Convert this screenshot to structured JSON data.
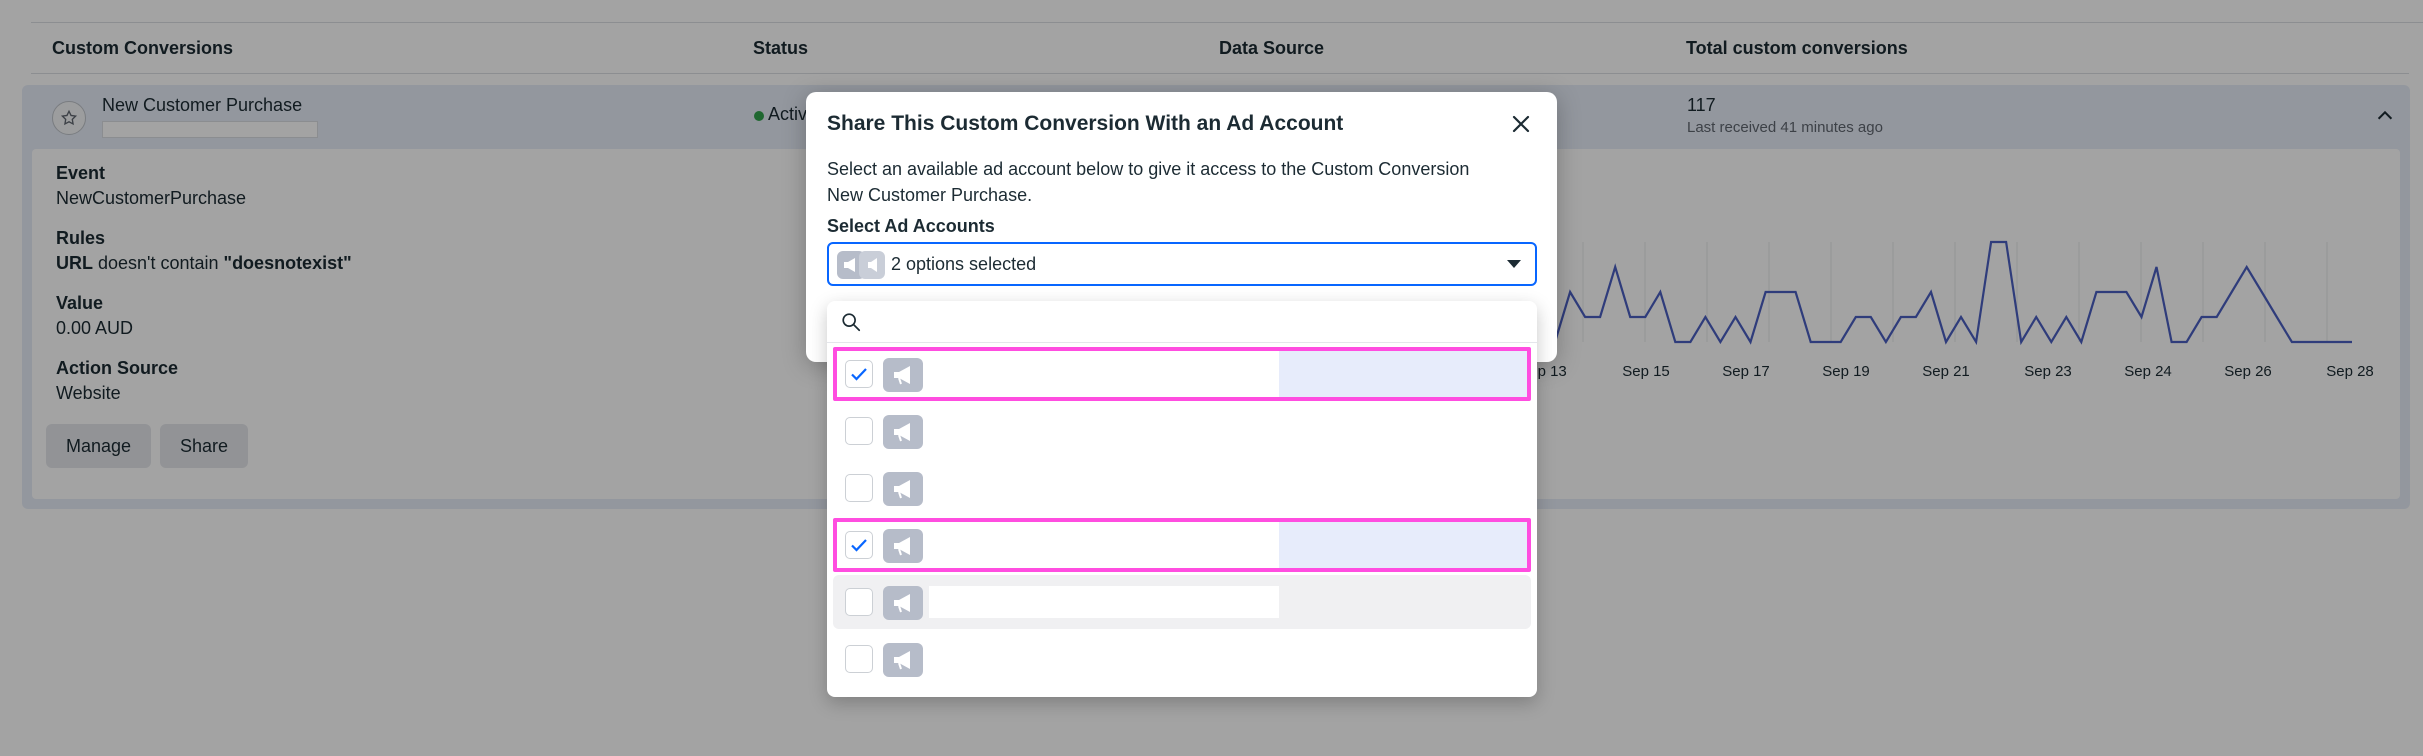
{
  "table": {
    "headers": [
      "Custom Conversions",
      "Status",
      "Data Source",
      "Total custom conversions"
    ]
  },
  "row": {
    "name": "New Customer Purchase",
    "status": "Active",
    "total": "117",
    "last_received": "Last received 41 minutes ago",
    "details": [
      {
        "label": "Event",
        "value": "NewCustomerPurchase"
      },
      {
        "label": "Rules",
        "value_prefix": "URL",
        "value_mid": " doesn't contain ",
        "value_quoted": "\"doesnotexist\""
      },
      {
        "label": "Value",
        "value": "0.00 AUD"
      },
      {
        "label": "Action Source",
        "value": "Website"
      }
    ],
    "buttons": {
      "manage": "Manage",
      "share": "Share"
    }
  },
  "chart_data": {
    "type": "line",
    "series": [
      {
        "color": "#4a5fc1",
        "values": [
          0,
          0,
          2,
          1,
          1,
          3,
          1,
          1,
          2,
          0,
          0,
          1,
          0,
          1,
          0,
          2,
          2,
          2,
          0,
          0,
          0,
          1,
          1,
          0,
          1,
          1,
          2,
          0,
          1,
          0,
          4,
          4,
          0,
          1,
          0,
          1,
          0,
          2,
          2,
          2,
          1,
          3,
          0,
          0,
          1,
          1,
          2,
          3,
          2,
          1,
          0,
          0,
          0,
          0,
          0
        ]
      }
    ],
    "x_tick_labels": [
      "Sep 13",
      "Sep 15",
      "Sep 17",
      "Sep 19",
      "Sep 21",
      "Sep 23",
      "Sep 24",
      "Sep 26",
      "Sep 28"
    ],
    "grid": true
  },
  "modal": {
    "title": "Share This Custom Conversion With an Ad Account",
    "description": "Select an available ad account below to give it access to the Custom Conversion New Customer Purchase.",
    "select_label": "Select Ad Accounts",
    "select_value": "2 options selected",
    "close_icon": "close-icon"
  },
  "dropdown": {
    "search_placeholder": "",
    "options": [
      {
        "checked": true,
        "highlighted": true
      },
      {
        "checked": false,
        "highlighted": false
      },
      {
        "checked": false,
        "highlighted": false
      },
      {
        "checked": true,
        "highlighted": true
      },
      {
        "checked": false,
        "highlighted": false,
        "hover": true
      },
      {
        "checked": false,
        "highlighted": false
      }
    ]
  },
  "colors": {
    "accent": "#0866ff",
    "highlight_outline": "#ff4de0",
    "status_active": "#31a24c",
    "chart_line": "#4a5fc1"
  }
}
